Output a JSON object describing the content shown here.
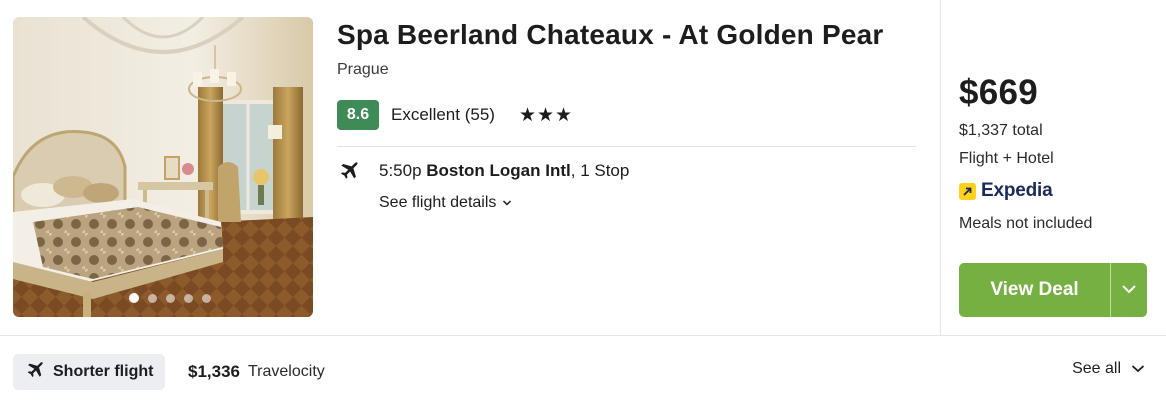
{
  "hotel": {
    "name": "Spa Beerland Chateaux - At Golden Pear",
    "city": "Prague",
    "score": "8.6",
    "rating_text": "Excellent (55)",
    "stars": "★★★"
  },
  "gallery": {
    "image_count": 5,
    "active_index": 0
  },
  "flight": {
    "time": "5:50p ",
    "airport": "Boston Logan Intl",
    "stops": ", 1 Stop",
    "details_link": "See flight details",
    "icon": "airplane-icon"
  },
  "deal": {
    "price": "$669",
    "total": "$1,337 total",
    "package": "Flight + Hotel",
    "provider": "Expedia",
    "meals": "Meals not included",
    "button_label": "View Deal",
    "button_color": "#76b043"
  },
  "alternate": {
    "chip_label": "Shorter flight",
    "price": "$1,336",
    "provider": "Travelocity",
    "see_all": "See all"
  },
  "colors": {
    "score_badge": "#3e8b57",
    "provider_logo": "#ffd11a",
    "provider_text": "#1b2a5e"
  }
}
